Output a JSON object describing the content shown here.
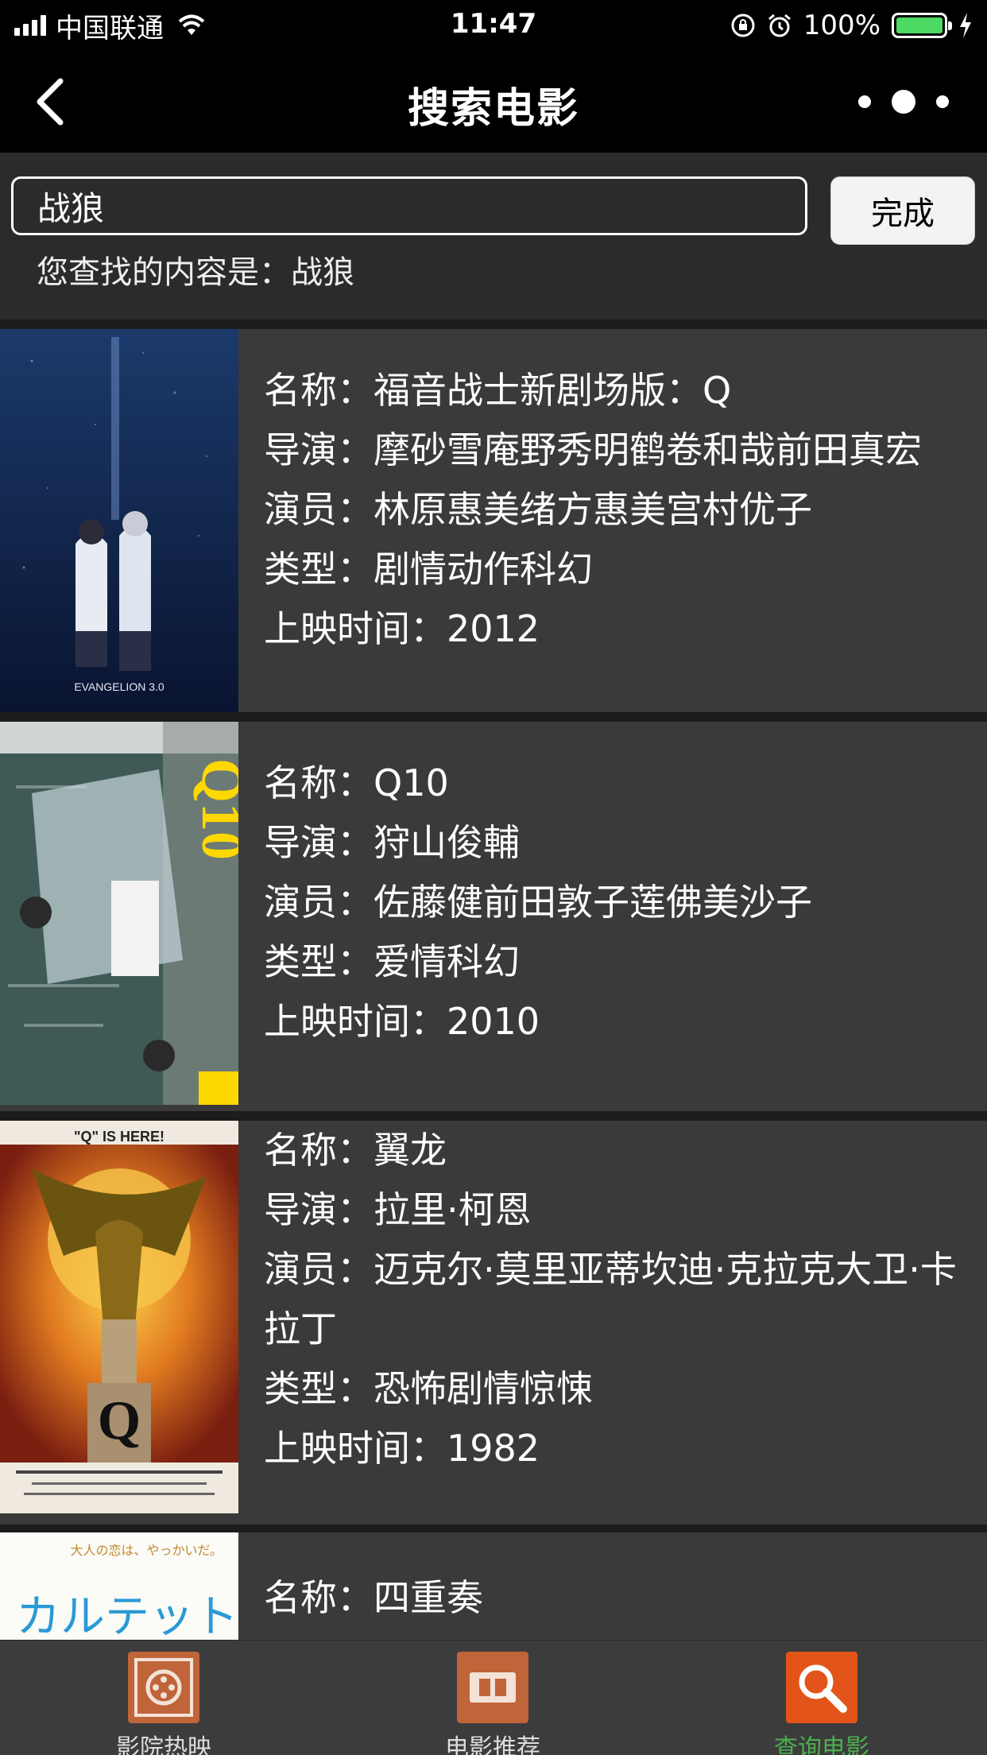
{
  "status_bar": {
    "carrier": "中国联通",
    "time": "11:47",
    "battery": "100%"
  },
  "nav": {
    "title": "搜索电影"
  },
  "search": {
    "value": "战狼",
    "done_label": "完成",
    "query_prefix": "您查找的内容是：",
    "query_value": "战狼"
  },
  "movies": [
    {
      "name_label": "名称：",
      "name": "福音战士新剧场版：Q",
      "director_label": "导演：",
      "director": "摩砂雪庵野秀明鹤卷和哉前田真宏",
      "cast_label": "演员：",
      "cast": "林原惠美绪方惠美宫村优子",
      "genre_label": "类型：",
      "genre": "剧情动作科幻",
      "year_label": "上映时间：",
      "year": "2012"
    },
    {
      "name_label": "名称：",
      "name": "Q10",
      "director_label": "导演：",
      "director": "狩山俊輔",
      "cast_label": "演员：",
      "cast": "佐藤健前田敦子莲佛美沙子",
      "genre_label": "类型：",
      "genre": "爱情科幻",
      "year_label": "上映时间：",
      "year": "2010"
    },
    {
      "name_label": "名称：",
      "name": "翼龙",
      "director_label": "导演：",
      "director": "拉里·柯恩",
      "cast_label": "演员：",
      "cast": "迈克尔·莫里亚蒂坎迪·克拉克大卫·卡拉丁",
      "genre_label": "类型：",
      "genre": "恐怖剧情惊悚",
      "year_label": "上映时间：",
      "year": "1982"
    },
    {
      "name_label": "名称：",
      "name": "四重奏"
    }
  ],
  "posters": {
    "p1_text": "EVANGELION 3.0",
    "p2_text": "Q10",
    "p3_title": "\"Q\" IS HERE!",
    "p3_letter": "Q",
    "p4_text": "カルテット",
    "p4_top": "大人の恋は、やっかいだ。"
  },
  "tabs": [
    {
      "label": "影院热映",
      "icon": "film-reel-icon"
    },
    {
      "label": "电影推荐",
      "icon": "ticket-icon"
    },
    {
      "label": "查询电影",
      "icon": "search-icon"
    }
  ],
  "colors": {
    "active_tab": "#4caf50",
    "tab_icon": "#c0643a",
    "search_tab_icon": "#e3541a"
  }
}
